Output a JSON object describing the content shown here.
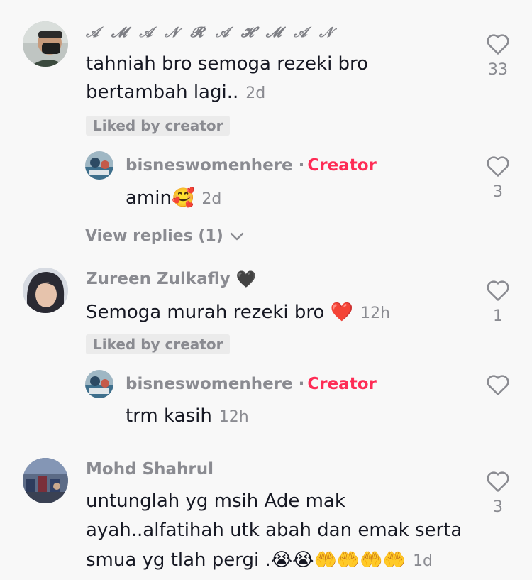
{
  "comments": [
    {
      "author": "𝒜 𝓜 𝒜 𝒩 𝓡 𝒜 𝓗 𝓜 𝒜 𝒩",
      "text_line1": "tahniah bro semoga rezeki bro",
      "text_line2": "bertambah lagi..",
      "time": "2d",
      "liked_by_creator": "Liked by creator",
      "likes": "33",
      "reply": {
        "author": "bisneswomenhere",
        "creator_label": "Creator",
        "separator": "·",
        "text": "amin",
        "emoji": "🥰",
        "time": "2d",
        "likes": "3"
      },
      "view_replies": "View replies (1)"
    },
    {
      "author": "Zureen Zulkafly",
      "author_emoji": "🖤",
      "text": "Semoga murah rezeki bro",
      "text_emoji": "❤️",
      "time": "12h",
      "liked_by_creator": "Liked by creator",
      "likes": "1",
      "reply": {
        "author": "bisneswomenhere",
        "creator_label": "Creator",
        "separator": "·",
        "text": "trm kasih",
        "time": "12h",
        "likes": ""
      }
    },
    {
      "author": "Mohd Shahrul",
      "text_line1": "untunglah yg msih Ade mak",
      "text_line2": "ayah..alfatihah utk abah dan emak serta",
      "text_line3": "smua yg tlah pergi .",
      "text_emojis": "😭😭🤲🤲🤲🤲",
      "time": "1d",
      "likes": "3"
    }
  ],
  "colors": {
    "background": "#f8f8f8",
    "text": "#161823",
    "muted": "#8a8b91",
    "creator": "#fe2c55",
    "badge_bg": "#ebebeb"
  },
  "icons": [
    "heart-outline-icon",
    "chevron-down-icon"
  ]
}
